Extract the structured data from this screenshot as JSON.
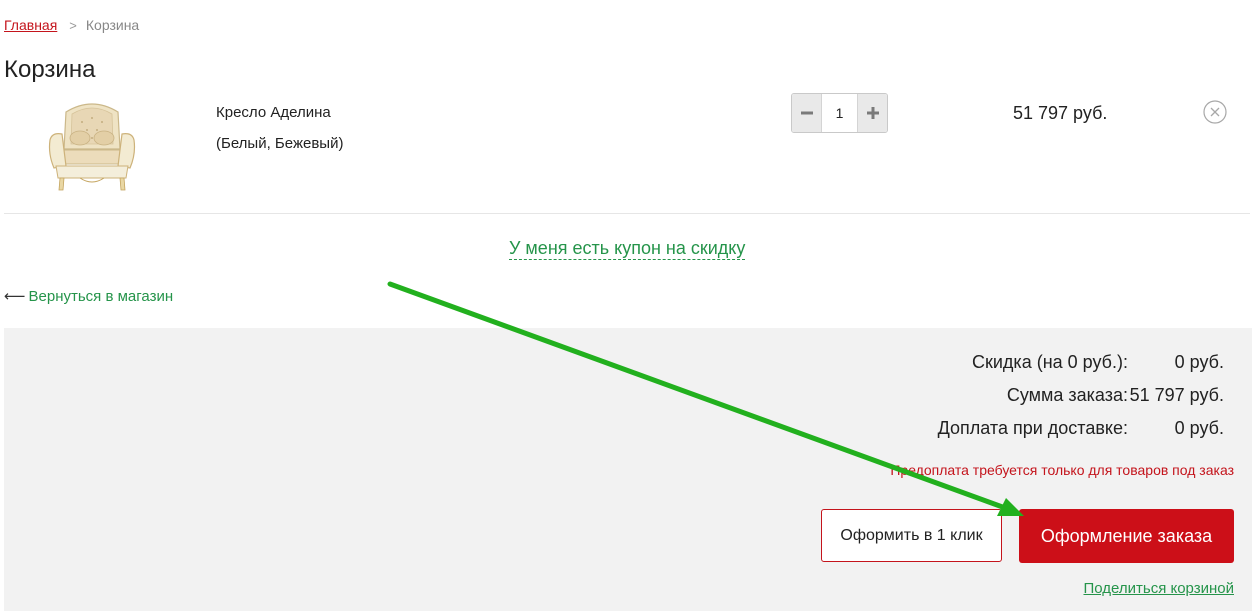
{
  "breadcrumb": {
    "home": "Главная",
    "separator": ">",
    "current": "Корзина"
  },
  "page_title": "Корзина",
  "cart": {
    "items": [
      {
        "name": "Кресло Аделина",
        "variant": "(Белый, Бежевый)",
        "quantity": "1",
        "price": "51 797 руб.",
        "image_icon": "armchair-product-image"
      }
    ]
  },
  "coupon_link": "У меня есть купон на скидку",
  "back_link": {
    "arrow": "⟵",
    "label": "Вернуться в магазин"
  },
  "summary": {
    "discount_label": "Скидка (на 0 руб.):",
    "discount_value": "0 руб.",
    "total_label": "Сумма заказа:",
    "total_value": "51 797 руб.",
    "delivery_label": "Доплата при доставке:",
    "delivery_value": "0 руб.",
    "prepay_note": "Предоплата требуется только для товаров под заказ",
    "one_click_button": "Оформить в 1 клик",
    "checkout_button": "Оформление заказа",
    "share_link": "Поделиться корзиной"
  },
  "colors": {
    "accent_red": "#cc0f18",
    "link_green": "#25944a",
    "annotation_arrow": "#22b01e",
    "panel_bg": "#f2f2f2"
  }
}
